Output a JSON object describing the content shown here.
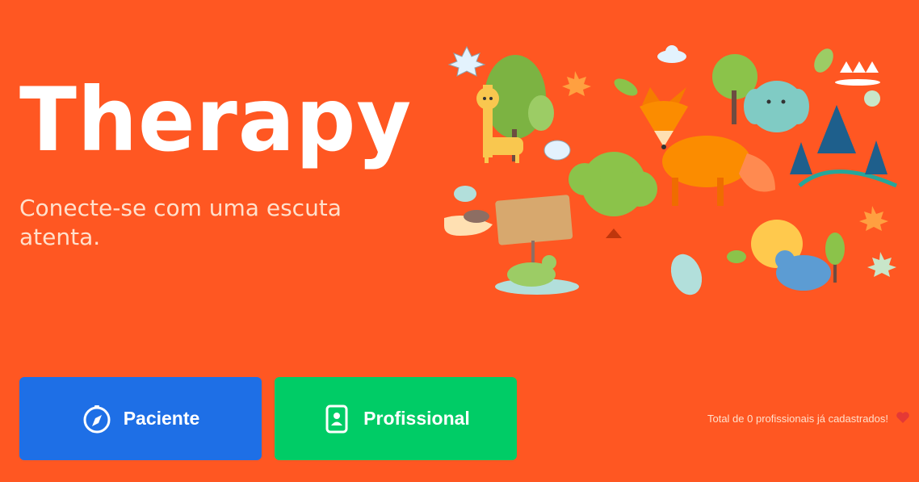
{
  "hero": {
    "title": "Therapy",
    "subtitle": "Conecte-se com uma escuta atenta."
  },
  "buttons": {
    "paciente": {
      "label": "Paciente",
      "icon": "compass-icon",
      "color": "#1E6FE6"
    },
    "profissional": {
      "label": "Profissional",
      "icon": "id-badge-icon",
      "color": "#00CC66"
    }
  },
  "footer": {
    "note": "Total de 0 profissionais já cadastrados!",
    "icon": "heart-icon"
  },
  "colors": {
    "background": "#FF5722"
  }
}
